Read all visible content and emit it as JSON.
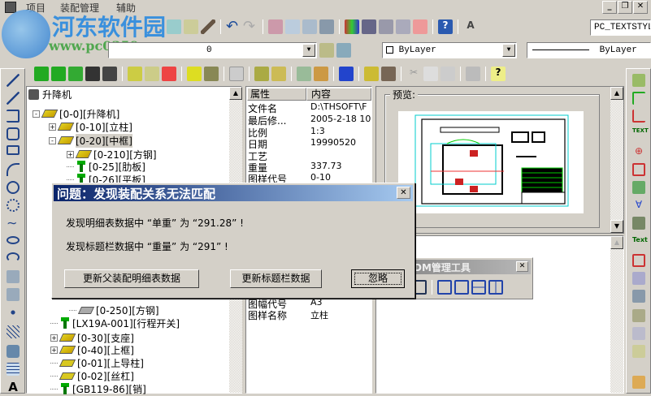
{
  "menu": {
    "items": [
      "项目",
      "装配管理",
      "辅助"
    ]
  },
  "watermark": {
    "name": "河东软件园",
    "url": "www.pc0359.cn"
  },
  "toolbar2": {
    "layer_value": "0",
    "color_value": "ByLayer",
    "linetype_value": "ByLayer"
  },
  "toolbar1": {
    "textstyle_value": "PC_TEXTSTYLE"
  },
  "tree": {
    "root": "升降机",
    "items": [
      {
        "label": "[0-0][升降机]",
        "type": "asm",
        "expand": "-"
      },
      {
        "label": "[0-10][立柱]",
        "type": "asm",
        "expand": "+"
      },
      {
        "label": "[0-20][中框]",
        "type": "asm",
        "expand": "-"
      },
      {
        "label": "[0-210][方钢]",
        "type": "asm",
        "expand": "+"
      },
      {
        "label": "[0-25][肋板]",
        "type": "std",
        "expand": ""
      },
      {
        "label": "[0-26][平板]",
        "type": "std",
        "expand": ""
      },
      {
        "label": "[0-250][方钢]",
        "type": "partg",
        "expand": ""
      },
      {
        "label": "[LX19A-001][行程开关]",
        "type": "std",
        "expand": ""
      },
      {
        "label": "[0-30][支座]",
        "type": "asm",
        "expand": "+"
      },
      {
        "label": "[0-40][上框]",
        "type": "asm",
        "expand": "+"
      },
      {
        "label": "[0-01][上导柱]",
        "type": "part",
        "expand": ""
      },
      {
        "label": "[0-02][丝杠]",
        "type": "part",
        "expand": ""
      },
      {
        "label": "[GB119-86][销]",
        "type": "std",
        "expand": ""
      }
    ]
  },
  "properties": {
    "headers": [
      "属性",
      "内容"
    ],
    "rows": [
      {
        "k": "文件名",
        "v": "D:\\THSOFT\\F"
      },
      {
        "k": "最后修...",
        "v": "2005-2-18 10"
      },
      {
        "k": "比例",
        "v": "1:3"
      },
      {
        "k": "日期",
        "v": "19990520"
      },
      {
        "k": "工艺",
        "v": ""
      },
      {
        "k": "重量",
        "v": "337.73"
      },
      {
        "k": "图样代号",
        "v": "0-10"
      },
      {
        "k": "图幅代号",
        "v": "A3"
      },
      {
        "k": "图样名称",
        "v": "立柱"
      }
    ]
  },
  "preview": {
    "label": "预览:"
  },
  "floating_toolbar": {
    "title": "DM管理工具"
  },
  "dialog": {
    "title": "问题：发现装配关系无法匹配",
    "line1": "发现明细表数据中 “单重” 为 “291.28” !",
    "line2": "发现标题栏数据中 “重量” 为 “291” !",
    "btn_update_parent": "更新父装配明细表数据",
    "btn_update_title": "更新标题栏数据",
    "btn_ignore": "忽略"
  },
  "window_controls": {
    "min": "_",
    "restore": "❐",
    "close": "✕"
  }
}
